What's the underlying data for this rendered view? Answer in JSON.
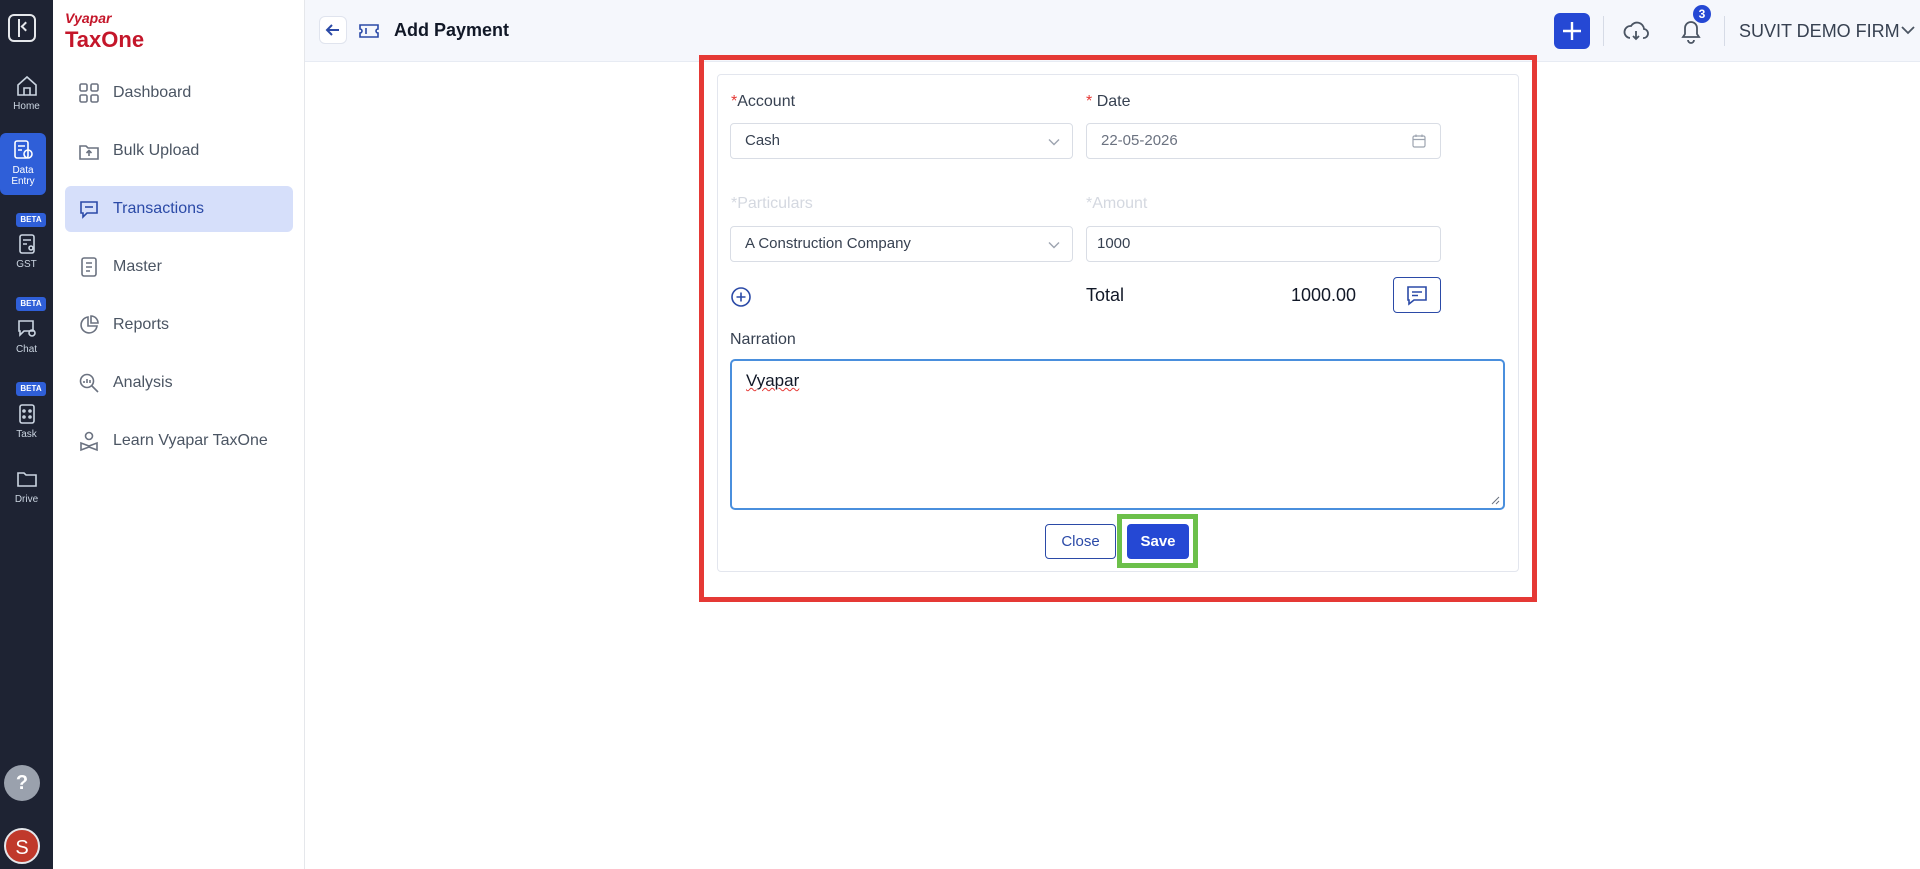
{
  "rail": {
    "items": [
      {
        "label": "Home"
      },
      {
        "label": "Data\nEntry",
        "line1": "Data",
        "line2": "Entry"
      },
      {
        "label": "GST",
        "badge": "BETA"
      },
      {
        "label": "Chat",
        "badge": "BETA"
      },
      {
        "label": "Task",
        "badge": "BETA"
      },
      {
        "label": "Drive"
      }
    ],
    "help": "?",
    "avatar": "S"
  },
  "brand": {
    "line1": "Vyapar",
    "line2": "TaxOne"
  },
  "sidebar": {
    "items": [
      {
        "label": "Dashboard"
      },
      {
        "label": "Bulk Upload"
      },
      {
        "label": "Transactions"
      },
      {
        "label": "Master"
      },
      {
        "label": "Reports"
      },
      {
        "label": "Analysis"
      },
      {
        "label": "Learn Vyapar TaxOne"
      }
    ]
  },
  "header": {
    "title": "Add Payment",
    "notification_count": "3",
    "firm": "SUVIT DEMO FIRM"
  },
  "form": {
    "account_label": "Account",
    "account_value": "Cash",
    "date_label": "Date",
    "date_value": "22-05-2026",
    "particulars_label": "*Particulars",
    "particulars_value": "A Construction Company",
    "amount_label": "*Amount",
    "amount_value": "1000",
    "total_label": "Total",
    "total_value": "1000.00",
    "narration_label": "Narration",
    "narration_value": "Vyapar",
    "close_label": "Close",
    "save_label": "Save"
  },
  "colors": {
    "accent": "#2548d4",
    "highlight_red": "#e53935",
    "highlight_green": "#6cc04a"
  }
}
